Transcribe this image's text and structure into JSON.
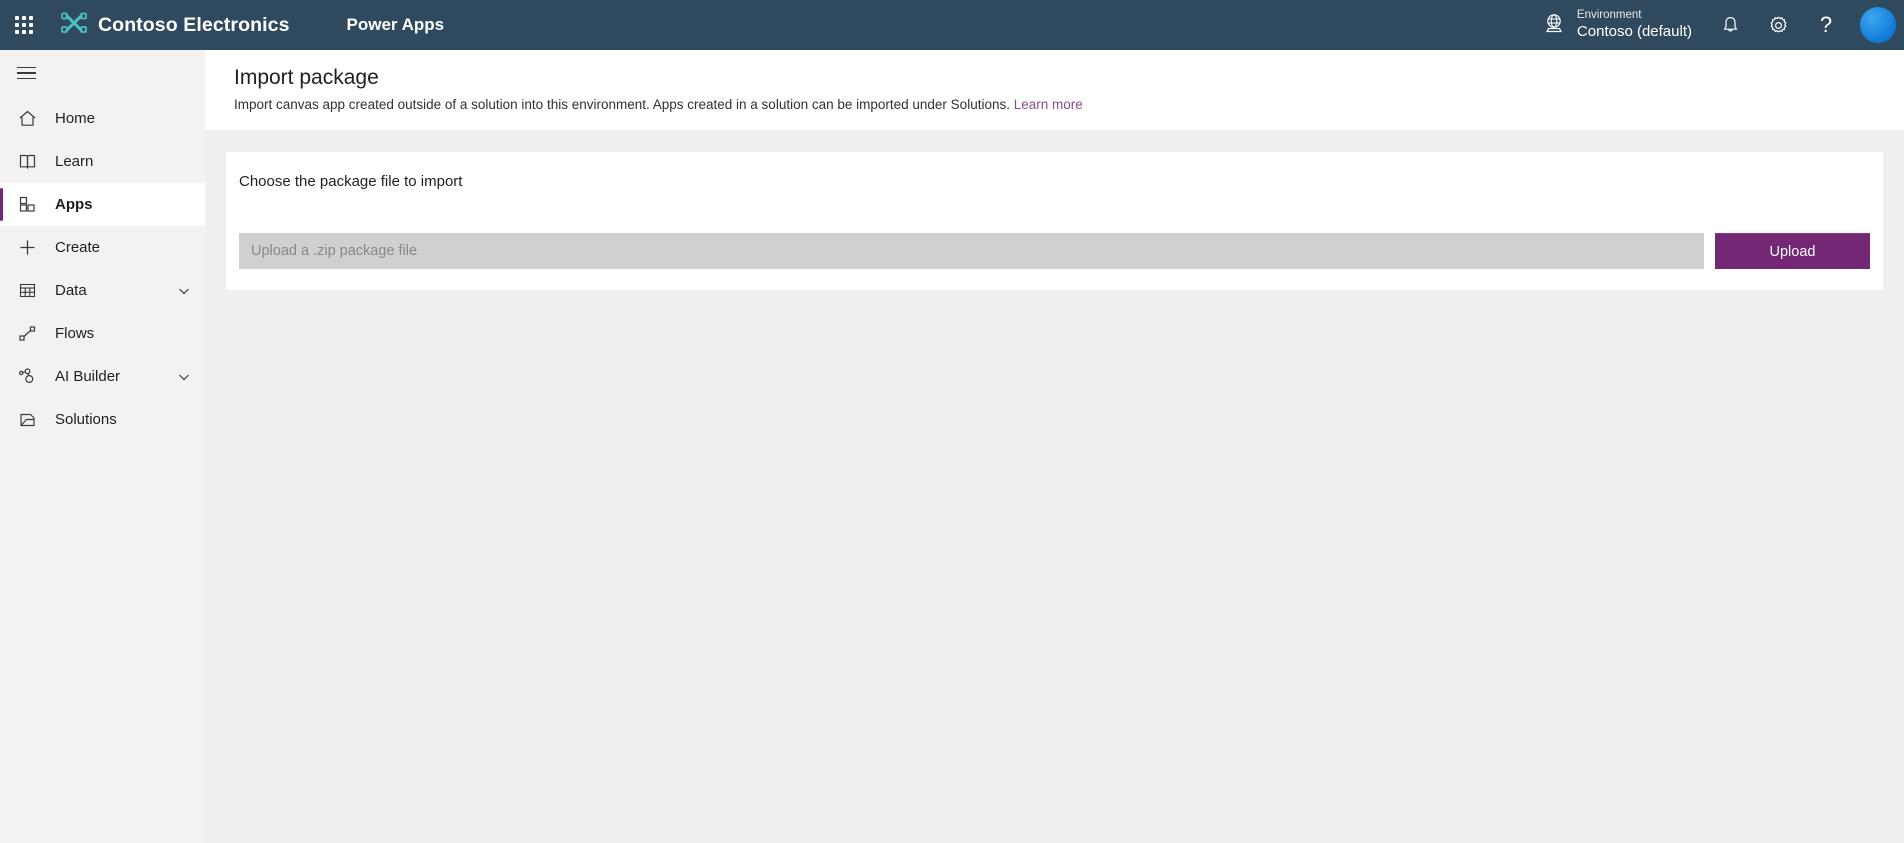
{
  "header": {
    "waffle_icon": "app-launcher-icon",
    "brand_name": "Contoso Electronics",
    "brand_logo_icon": "contoso-logo-icon",
    "app_title": "Power Apps",
    "environment": {
      "icon": "globe-icon",
      "label": "Environment",
      "value": "Contoso (default)"
    },
    "icons": [
      {
        "name": "notifications-bell-icon",
        "glyph": "bell"
      },
      {
        "name": "settings-gear-icon",
        "glyph": "gear"
      },
      {
        "name": "help-question-icon",
        "glyph": "?"
      }
    ],
    "avatar": "user-avatar",
    "colors": {
      "background": "#2f4a5e",
      "brand_logo": "#4cc2c4",
      "avatar": "#0e7ad6"
    }
  },
  "sidebar": {
    "hamburger_label": "Menu",
    "items": [
      {
        "label": "Home",
        "icon": "home-icon",
        "selected": false,
        "expandable": false
      },
      {
        "label": "Learn",
        "icon": "book-icon",
        "selected": false,
        "expandable": false
      },
      {
        "label": "Apps",
        "icon": "apps-grid-icon",
        "selected": true,
        "expandable": false
      },
      {
        "label": "Create",
        "icon": "plus-icon",
        "selected": false,
        "expandable": false
      },
      {
        "label": "Data",
        "icon": "table-icon",
        "selected": false,
        "expandable": true
      },
      {
        "label": "Flows",
        "icon": "flow-icon",
        "selected": false,
        "expandable": false
      },
      {
        "label": "AI Builder",
        "icon": "ai-builder-icon",
        "selected": false,
        "expandable": true
      },
      {
        "label": "Solutions",
        "icon": "solutions-icon",
        "selected": false,
        "expandable": false
      }
    ],
    "accent_color": "#742774"
  },
  "page": {
    "title": "Import package",
    "description_text": "Import canvas app created outside of a solution into this environment. Apps created in a solution can be imported under Solutions.",
    "learn_more_label": "Learn more"
  },
  "import_card": {
    "title": "Choose the package file to import",
    "file_input_placeholder": "Upload a .zip package file",
    "file_input_value": "",
    "upload_button_label": "Upload",
    "upload_button_color": "#742774"
  }
}
